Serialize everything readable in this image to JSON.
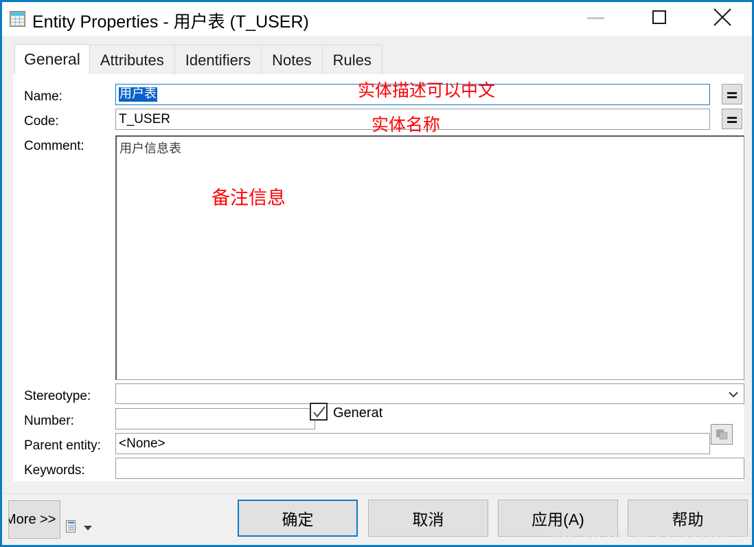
{
  "window": {
    "title": "Entity Properties - 用户表 (T_USER)",
    "icon": "table-icon",
    "controls": {
      "minimize": "minimize-icon",
      "maximize": "maximize-icon",
      "close": "close-icon"
    },
    "border_color": "#0d7bc4"
  },
  "tabs": [
    {
      "label": "General",
      "active": true
    },
    {
      "label": "Attributes",
      "active": false
    },
    {
      "label": "Identifiers",
      "active": false
    },
    {
      "label": "Notes",
      "active": false
    },
    {
      "label": "Rules",
      "active": false
    }
  ],
  "form": {
    "name": {
      "label": "Name:",
      "value": "用户表",
      "selected": true,
      "focused": true,
      "button_glyph": "="
    },
    "code": {
      "label": "Code:",
      "value": "T_USER",
      "button_glyph": "="
    },
    "comment": {
      "label": "Comment:",
      "value": "用户信息表"
    },
    "stereotype": {
      "label": "Stereotype:",
      "value": "",
      "icon": "chevron-down-icon"
    },
    "number": {
      "label": "Number:",
      "value": "",
      "checkbox_label": "Generat",
      "checkbox_checked": true
    },
    "parent_entity": {
      "label": "Parent entity:",
      "value": "<None>",
      "icon": "select-object-icon"
    },
    "keywords": {
      "label": "Keywords:",
      "value": ""
    }
  },
  "annotations": {
    "name": "实体描述可以中文",
    "code": "实体名称",
    "comment": "备注信息",
    "color": "#ff0000"
  },
  "footer": {
    "more": "More >>",
    "report_icon": "report-icon",
    "report_caret": "caret-down-icon",
    "ok": "确定",
    "cancel": "取消",
    "apply": "应用(A)",
    "help": "帮助"
  },
  "watermark": "https://dpb-bobbkaoya-sm.blog.csdn.net"
}
